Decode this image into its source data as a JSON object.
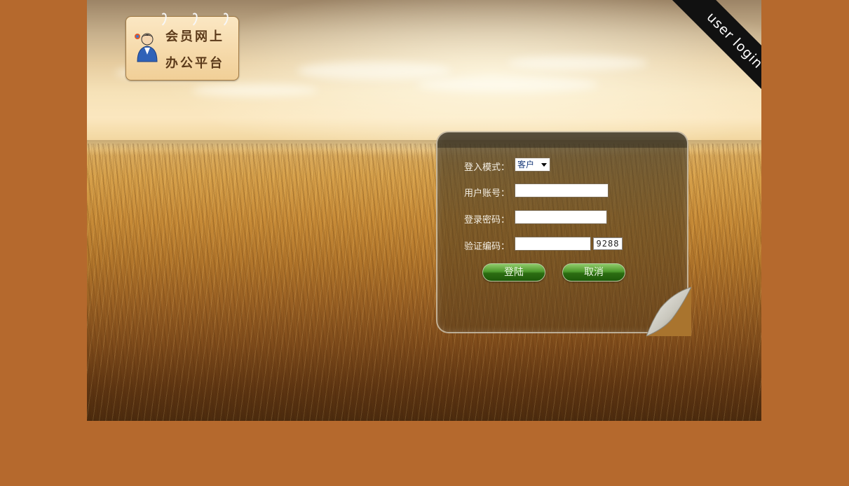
{
  "logo": {
    "line1": "会员网上",
    "line2": "办公平台"
  },
  "corner_ribbon": {
    "text": "user login"
  },
  "login_form": {
    "mode_label": "登入模式：",
    "mode_selected": "客户",
    "account_label": "用户账号：",
    "account_value": "",
    "password_label": "登录密码：",
    "password_value": "",
    "captcha_label": "验证编码：",
    "captcha_value": "",
    "captcha_code": "9288",
    "login_button": "登陆",
    "cancel_button": "取消"
  },
  "colors": {
    "page_background": "#b5692d",
    "button_green": "#2c6d12",
    "ribbon": "#111111"
  }
}
